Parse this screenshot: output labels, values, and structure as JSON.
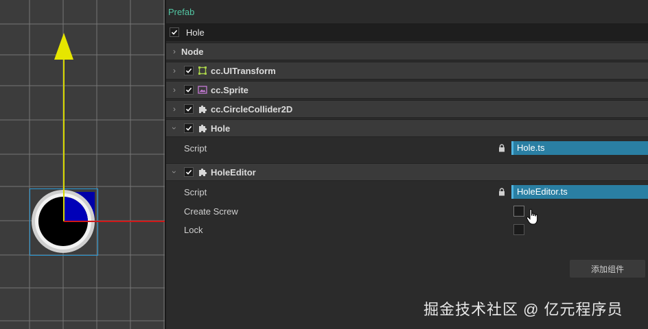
{
  "inspector": {
    "prefab_label": "Prefab",
    "node_name": "Hole",
    "node_section": "Node",
    "components": [
      {
        "name": "cc.UITransform",
        "icon": "transform-icon",
        "enabled": true
      },
      {
        "name": "cc.Sprite",
        "icon": "sprite-icon",
        "enabled": true
      },
      {
        "name": "cc.CircleCollider2D",
        "icon": "puzzle-icon",
        "enabled": true
      },
      {
        "name": "Hole",
        "icon": "puzzle-icon",
        "enabled": true,
        "expanded": true,
        "props": [
          {
            "label": "Script",
            "value": "Hole.ts"
          }
        ]
      },
      {
        "name": "HoleEditor",
        "icon": "puzzle-icon",
        "enabled": true,
        "expanded": true,
        "props": [
          {
            "label": "Script",
            "value": "HoleEditor.ts"
          },
          {
            "label": "Create Screw",
            "value": false
          },
          {
            "label": "Lock",
            "value": false
          }
        ]
      }
    ],
    "add_component_label": "添加组件"
  },
  "watermark": "掘金技术社区 @ 亿元程序员",
  "colors": {
    "prefab_label": "#53c7a4",
    "asset_field": "#2a7fa3",
    "gizmo_y_axis": "#d8d800",
    "gizmo_x_axis": "#d01818",
    "selection_box": "#2a9bd8"
  }
}
